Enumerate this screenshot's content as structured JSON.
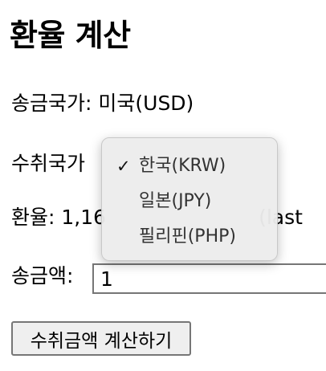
{
  "page": {
    "title": "환율 계산"
  },
  "form": {
    "send_country_label": "송금국가:",
    "send_country_value": "미국(USD)",
    "receive_country_label": "수취국가",
    "rate_label": "환율:",
    "rate_value_visible_start": "1,16",
    "rate_value_visible_end": "(last",
    "amount_label": "송금액:",
    "amount_value": "1",
    "calc_button_label": "수취금액 계산하기"
  },
  "dropdown": {
    "selected_index": 0,
    "check_mark": "✓",
    "options": [
      {
        "label": "한국(KRW)"
      },
      {
        "label": "일본(JPY)"
      },
      {
        "label": "필리핀(PHP)"
      }
    ]
  }
}
